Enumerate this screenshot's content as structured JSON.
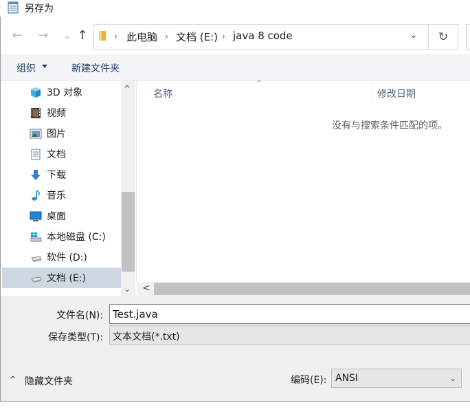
{
  "window": {
    "title": "另存为"
  },
  "nav": {
    "back_glyph": "←",
    "forward_glyph": "→",
    "recent_glyph": "⌄",
    "up_glyph": "↑",
    "breadcrumbs": [
      "此电脑",
      "文档 (E:)",
      "java 8 code"
    ],
    "separator": "›",
    "dropdown_glyph": "⌄",
    "refresh_glyph": "↻"
  },
  "toolbar": {
    "organize_label": "组织",
    "new_folder_label": "新建文件夹"
  },
  "sidebar": {
    "items": [
      {
        "label": "3D 对象",
        "icon": "cube-3d-icon"
      },
      {
        "label": "视频",
        "icon": "video-icon"
      },
      {
        "label": "图片",
        "icon": "pictures-icon"
      },
      {
        "label": "文档",
        "icon": "documents-icon"
      },
      {
        "label": "下载",
        "icon": "download-icon"
      },
      {
        "label": "音乐",
        "icon": "music-icon"
      },
      {
        "label": "桌面",
        "icon": "desktop-icon"
      },
      {
        "label": "本地磁盘 (C:)",
        "icon": "windows-drive-icon"
      },
      {
        "label": "软件 (D:)",
        "icon": "drive-icon"
      },
      {
        "label": "文档 (E:)",
        "icon": "drive-icon",
        "selected": true
      }
    ],
    "scroll_up": "^",
    "scroll_down": "⌄"
  },
  "content": {
    "columns": [
      "名称",
      "修改日期"
    ],
    "sort_glyph": "^",
    "empty_message": "没有与搜索条件匹配的项。",
    "hscroll_left": "<"
  },
  "form": {
    "filename_label": "文件名(N):",
    "filename_value": "Test.java",
    "filetype_label": "保存类型(T):",
    "filetype_value": "文本文档(*.txt)",
    "hide_folders_label": "隐藏文件夹",
    "hide_caret": "^",
    "encoding_label": "编码(E):",
    "encoding_value": "ANSI",
    "encoding_caret": "⌄"
  },
  "colors": {
    "toolbar_link": "#1f3d6a",
    "selected_bg": "#cfd8e2",
    "folder_yellow": "#e8b53a"
  }
}
